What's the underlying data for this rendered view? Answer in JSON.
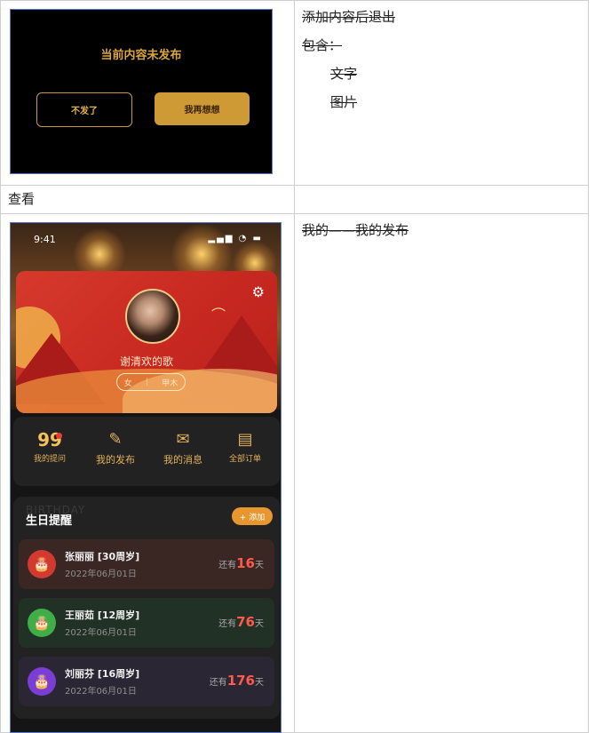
{
  "row1": {
    "dialog": {
      "title": "当前内容未发布",
      "cancel_label": "不发了",
      "confirm_label": "我再想想"
    },
    "notes": {
      "line1": "添加内容后退出",
      "line2": "包含：",
      "item1": "文字",
      "item2": "图片"
    }
  },
  "row2": {
    "label": "查看"
  },
  "row3": {
    "note": "我的——我的发布",
    "phone": {
      "status_time": "9:41",
      "status_icons": "▂▄▆ ◔ ▬",
      "nickname": "谢清欢的歌",
      "gender": "女",
      "tag": "甲木",
      "menu": {
        "ask_count": "99",
        "ask_label": "我的提问",
        "publish_label": "我的发布",
        "message_label": "我的消息",
        "orders_label": "全部订单"
      },
      "birthday": {
        "title": "生日提醒",
        "watermark": "BIRTHDAY",
        "add_label": "+ 添加",
        "items": [
          {
            "name": "张丽丽 [30周岁]",
            "date": "2022年06月01日",
            "prefix": "还有",
            "days": "16",
            "suffix": "天",
            "color": "#d33a2f",
            "bg": "#3a2623"
          },
          {
            "name": "王丽茹 [12周岁]",
            "date": "2022年06月01日",
            "prefix": "还有",
            "days": "76",
            "suffix": "天",
            "color": "#3fae48",
            "bg": "#213125"
          },
          {
            "name": "刘丽芬 [16周岁]",
            "date": "2022年06月01日",
            "prefix": "还有",
            "days": "176",
            "suffix": "天",
            "color": "#7a3ed4",
            "bg": "#2a2634"
          }
        ]
      }
    }
  }
}
